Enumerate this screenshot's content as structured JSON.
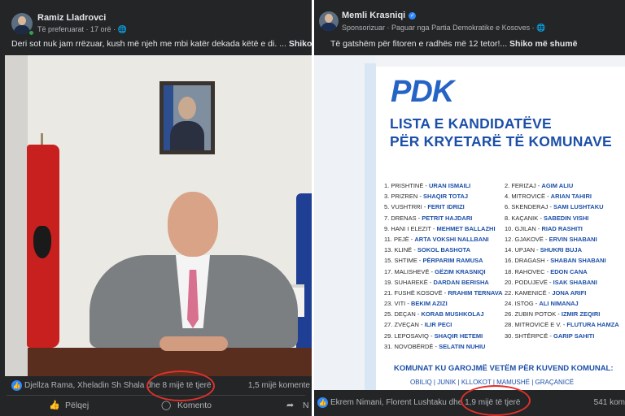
{
  "left_post": {
    "author": "Ramiz Lladrovci",
    "meta": "Të preferuarat · 17 orë · 🌐",
    "caption_text": "Deri sot nuk jam rrëzuar, kush më njeh me mbi katër dekada këtë e di. ...",
    "caption_more": "Shiko më shumë",
    "reactions_text": "Djellza Rama, Xheladin Sh Shala dhe 8 mijë të tjerë",
    "comments_text": "1,5 mijë komente",
    "actions": {
      "like": "Pëlqej",
      "comment": "Komento",
      "share": "N"
    },
    "icons": {
      "like": "thumbs-up-icon",
      "comment": "comment-icon",
      "share": "share-icon",
      "globe": "globe-icon"
    }
  },
  "right_post": {
    "author": "Memli Krasniqi",
    "meta": "Sponsorizuar · Paguar nga Partia Demokratike e Kosoves · 🌐",
    "caption_text": "Të gatshëm për fitoren e radhës më 12 tetor!...",
    "caption_more": "Shiko më shumë",
    "reactions_text": "Ekrem Nimani, Florent Lushtaku dhe 1,9 mijë të tjerë",
    "comments_text": "541 kom",
    "poster": {
      "logo": "PDK",
      "title_line1": "LISTA E KANDIDATËVE",
      "title_line2": "PËR KRYETARË TË KOMUNAVE",
      "candidates_col1": [
        {
          "prefix": "1. PRISHTINË -",
          "name": "URAN ISMAILI"
        },
        {
          "prefix": "3. PRIZREN -",
          "name": "SHAQIR TOTAJ"
        },
        {
          "prefix": "5. VUSHTRRI -",
          "name": "FERIT IDRIZI"
        },
        {
          "prefix": "7. DRENAS -",
          "name": "PETRIT HAJDARI"
        },
        {
          "prefix": "9. HANI I ELEZIT -",
          "name": "MEHMET BALLAZHI"
        },
        {
          "prefix": "11. PEJË -",
          "name": "ARTA VOKSHI NALLBANI"
        },
        {
          "prefix": "13. KLINË -",
          "name": "SOKOL BASHOTA"
        },
        {
          "prefix": "15. SHTIME -",
          "name": "PËRPARIM RAMUSA"
        },
        {
          "prefix": "17. MALISHEVË -",
          "name": "GËZIM KRASNIQI"
        },
        {
          "prefix": "19. SUHAREKË -",
          "name": "DARDAN BERISHA"
        },
        {
          "prefix": "21. FUSHË KOSOVË -",
          "name": "RRAHIM TERNAVA"
        },
        {
          "prefix": "23. VITI -",
          "name": "BEKIM AZIZI"
        },
        {
          "prefix": "25. DEÇAN -",
          "name": "KORAB MUSHKOLAJ"
        },
        {
          "prefix": "27. ZVEÇAN -",
          "name": "ILIR PECI"
        },
        {
          "prefix": "29. LEPOSAVIQ -",
          "name": "SHAQIR HETEMI"
        },
        {
          "prefix": "31. NOVOBËRDË -",
          "name": "SELATIN NUHIU"
        }
      ],
      "candidates_col2": [
        {
          "prefix": "2. FERIZAJ -",
          "name": "AGIM ALIU"
        },
        {
          "prefix": "4. MITROVICË -",
          "name": "ARIAN TAHIRI"
        },
        {
          "prefix": "6. SKENDERAJ -",
          "name": "SAMI LUSHTAKU"
        },
        {
          "prefix": "8. KAÇANIK -",
          "name": "SABEDIN VISHI"
        },
        {
          "prefix": "10. GJILAN -",
          "name": "RIAD RASHITI"
        },
        {
          "prefix": "12. GJAKOVË -",
          "name": "ERVIN SHABANI"
        },
        {
          "prefix": "14. UPJAN -",
          "name": "SHUKRI BUJA"
        },
        {
          "prefix": "16. DRAGASH -",
          "name": "SHABAN SHABANI"
        },
        {
          "prefix": "18. RAHOVEC -",
          "name": "EDON CANA"
        },
        {
          "prefix": "20. PODUJEVË -",
          "name": "ISAK SHABANI"
        },
        {
          "prefix": "22. KAMENICË -",
          "name": "JONA ARIFI"
        },
        {
          "prefix": "24. ISTOG -",
          "name": "ALI NIMANAJ"
        },
        {
          "prefix": "26. ZUBIN POTOK -",
          "name": "IZMIR ZEQIRI"
        },
        {
          "prefix": "28. MITROVICË E V. -",
          "name": "FLUTURA HAMZA"
        },
        {
          "prefix": "30. SHTËRPCË -",
          "name": "GARIP SAHITI"
        }
      ],
      "komunat_title": "KOMUNAT KU GAROJMË VETËM PËR KUVEND KOMUNAL:",
      "komunat_list": "OBILIQ  |  JUNIK  |  KLLOKOT  |  MAMUSHË  |  GRAÇANICË"
    }
  },
  "annotation_color": "#e0302a"
}
